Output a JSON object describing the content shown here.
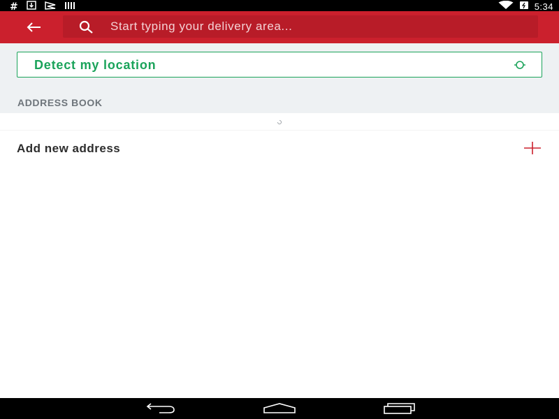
{
  "status_bar": {
    "hash_glyph": "#",
    "time": "5:34",
    "icons": [
      "hashtag-icon",
      "download-icon",
      "flag-icon",
      "barcode-icon",
      "wifi-icon",
      "battery-icon"
    ]
  },
  "app_bar": {
    "back_icon": "arrow-left-icon",
    "search_icon": "search-icon",
    "search_placeholder": "Start typing your delivery area...",
    "search_value": ""
  },
  "detect": {
    "label": "Detect my location",
    "icon": "location-target-icon"
  },
  "address_book": {
    "heading": "ADDRESS BOOK",
    "add_label": "Add new address",
    "add_icon": "plus-icon"
  },
  "nav_bar": {
    "icons": [
      "back-nav-icon",
      "home-nav-icon",
      "recents-nav-icon"
    ]
  },
  "colors": {
    "brand_red": "#cb202d",
    "search_field_red": "#b81c28",
    "accent_green": "#1aa35a",
    "section_bg": "#eef1f3",
    "heading_gray": "#6e757b"
  }
}
